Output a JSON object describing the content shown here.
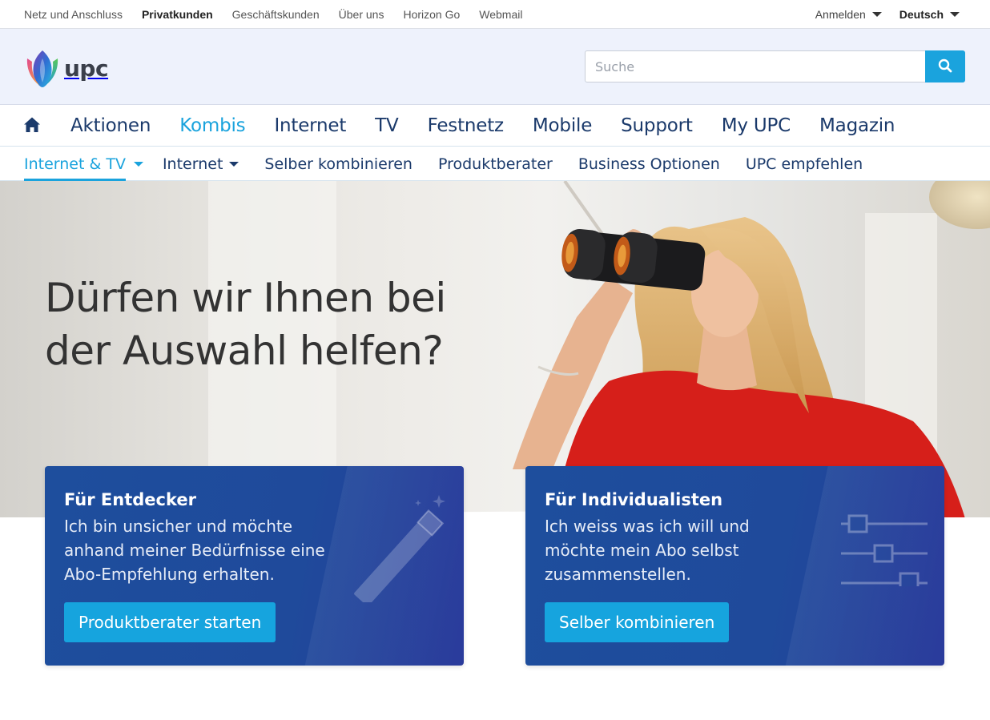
{
  "topbar": {
    "links": [
      {
        "label": "Netz und Anschluss",
        "active": false
      },
      {
        "label": "Privatkunden",
        "active": true
      },
      {
        "label": "Geschäftskunden",
        "active": false
      },
      {
        "label": "Über uns",
        "active": false
      },
      {
        "label": "Horizon Go",
        "active": false
      },
      {
        "label": "Webmail",
        "active": false
      }
    ],
    "login_label": "Anmelden",
    "language_label": "Deutsch"
  },
  "header": {
    "logo_text": "upc",
    "search": {
      "placeholder": "Suche",
      "value": ""
    }
  },
  "mainnav": {
    "items": [
      {
        "label": "Aktionen",
        "active": false
      },
      {
        "label": "Kombis",
        "active": true
      },
      {
        "label": "Internet",
        "active": false
      },
      {
        "label": "TV",
        "active": false
      },
      {
        "label": "Festnetz",
        "active": false
      },
      {
        "label": "Mobile",
        "active": false
      },
      {
        "label": "Support",
        "active": false
      },
      {
        "label": "My UPC",
        "active": false
      },
      {
        "label": "Magazin",
        "active": false
      }
    ]
  },
  "subnav": {
    "items": [
      {
        "label": "Internet & TV",
        "active": true,
        "dropdown": true
      },
      {
        "label": "Internet",
        "active": false,
        "dropdown": true
      },
      {
        "label": "Selber kombinieren",
        "active": false,
        "dropdown": false
      },
      {
        "label": "Produktberater",
        "active": false,
        "dropdown": false
      },
      {
        "label": "Business Optionen",
        "active": false,
        "dropdown": false
      },
      {
        "label": "UPC empfehlen",
        "active": false,
        "dropdown": false
      }
    ]
  },
  "hero": {
    "title_line1": "Dürfen wir Ihnen bei",
    "title_line2": "der Auswahl helfen?"
  },
  "cards": [
    {
      "title": "Für Entdecker",
      "text_lines": [
        "Ich bin unsicher und möchte",
        "anhand meiner Bedürfnisse eine",
        "Abo-Empfehlung erhalten."
      ],
      "button": "Produktberater starten",
      "icon": "magic-wand-icon"
    },
    {
      "title": "Für Individualisten",
      "text_lines": [
        "Ich weiss was ich will und",
        "möchte mein Abo selbst",
        "zusammenstellen."
      ],
      "button": "Selber kombinieren",
      "icon": "sliders-icon"
    }
  ],
  "colors": {
    "accent": "#1aa3dd",
    "navy": "#1b3a6b",
    "card_blue": "#1f4a9b",
    "header_bg": "#eef2fc"
  }
}
